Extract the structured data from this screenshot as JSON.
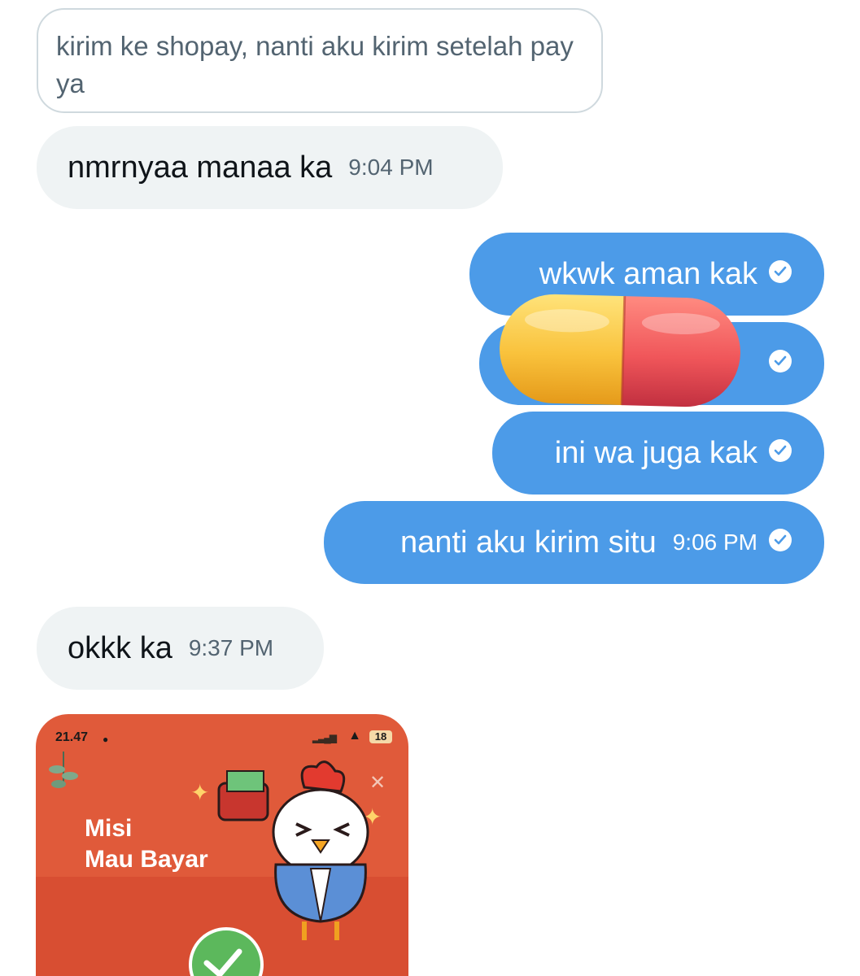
{
  "quoted_message": "kirim ke shopay, nanti aku kirim setelah pay ya",
  "messages": [
    {
      "text": "nmrnyaa manaa ka",
      "time": "9:04 PM"
    },
    {
      "text": "wkwk aman kak"
    },
    {
      "text": ""
    },
    {
      "text": "ini wa juga kak"
    },
    {
      "text": "nanti aku kirim situ",
      "time": "9:06 PM"
    },
    {
      "text": "okkk ka",
      "time": "9:37 PM"
    }
  ],
  "icons": {
    "read_check": "check-circle-icon",
    "overlay": "pill-emoji-icon"
  },
  "colors": {
    "incoming_bubble": "#eff3f4",
    "outgoing_bubble": "#4c9be8",
    "card_background": "#e05a3a"
  },
  "media_card": {
    "clock": "21.47",
    "battery": "18",
    "title": "Misi\nMau Bayar"
  }
}
